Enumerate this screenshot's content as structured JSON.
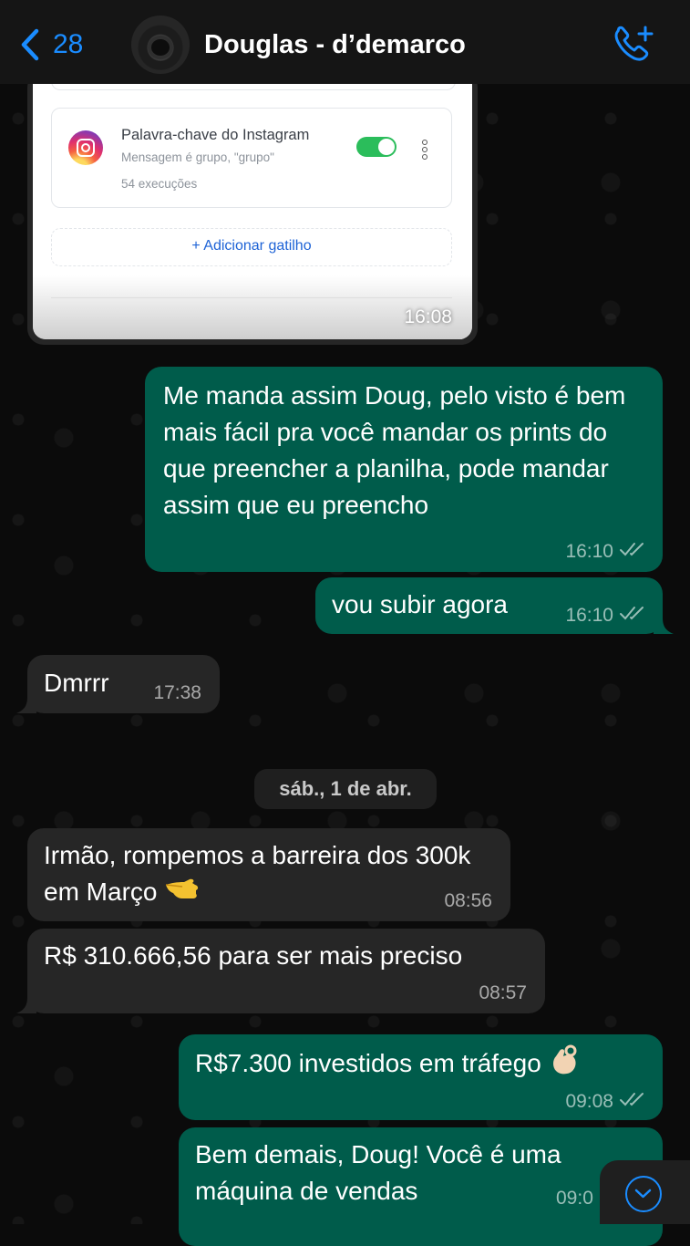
{
  "header": {
    "back_count": "28",
    "contact_name": "Douglas - d’demarco"
  },
  "shared_image": {
    "trigger_title": "Palavra-chave do Instagram",
    "trigger_subtitle": "Mensagem é grupo, \"grupo\"",
    "trigger_executions": "54 execuções",
    "add_trigger_label": "+ Adicionar gatilho",
    "time": "16:08"
  },
  "messages": [
    {
      "text": "Me manda assim Doug, pelo visto é bem mais fácil pra você mandar os prints do que preencher a planilha, pode mandar assim que eu preencho",
      "time": "16:10"
    },
    {
      "text": "vou subir agora",
      "time": "16:10"
    },
    {
      "text": "Dmrrr",
      "time": "17:38"
    },
    {
      "text": "Irmão, rompemos a barreira dos 300k em Março",
      "time": "08:56"
    },
    {
      "text": "R$ 310.666,56 para ser mais preciso",
      "time": "08:57"
    },
    {
      "text": "R$7.300 investidos em tráfego",
      "time": "09:08"
    },
    {
      "text": "Bem demais, Doug! Você é uma máquina de vendas",
      "time": "09:0"
    }
  ],
  "date_separator": "sáb., 1 de abr.",
  "colors": {
    "outgoing_bubble": "#005c4b",
    "incoming_bubble": "#262626",
    "accent": "#1a8cff"
  },
  "icons": {
    "back": "chevron-left-icon",
    "call": "add-call-icon",
    "read": "double-check-icon",
    "scroll": "chevron-down-icon"
  }
}
